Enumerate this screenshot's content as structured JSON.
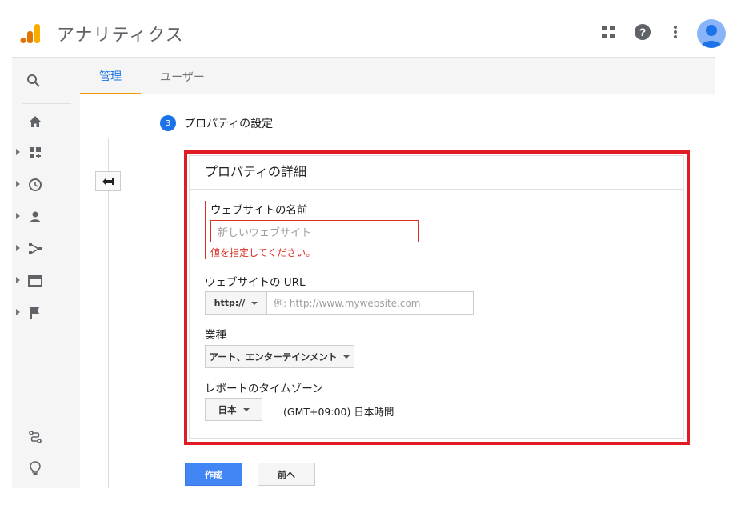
{
  "app": {
    "title": "アナリティクス"
  },
  "header": {
    "icons": [
      "apps-icon",
      "help-icon",
      "more-vert-icon",
      "avatar"
    ]
  },
  "tabs": [
    {
      "label": "管理",
      "active": true
    },
    {
      "label": "ユーザー",
      "active": false
    }
  ],
  "rail": {
    "items": [
      "search-icon",
      "home-icon",
      "dashboard-icon",
      "clock-icon",
      "person-icon",
      "acquisition-icon",
      "behavior-icon",
      "flag-icon",
      "route-icon",
      "lightbulb-icon"
    ]
  },
  "step": {
    "number": "3",
    "title": "プロパティの設定"
  },
  "form": {
    "section_title": "プロパティの詳細",
    "website_name": {
      "label": "ウェブサイトの名前",
      "placeholder": "新しいウェブサイト",
      "error": "値を指定してください。"
    },
    "website_url": {
      "label": "ウェブサイトの URL",
      "protocol": "http://",
      "placeholder": "例: http://www.mywebsite.com"
    },
    "industry": {
      "label": "業種",
      "value": "アート、エンターテインメント"
    },
    "timezone": {
      "label": "レポートのタイムゾーン",
      "country": "日本",
      "zone": "(GMT+09:00) 日本時間"
    }
  },
  "actions": {
    "create": "作成",
    "back": "前へ"
  },
  "colors": {
    "accent": "#1a73e8",
    "highlight": "#e01b22",
    "error": "#d93025",
    "tab_indicator": "#f29900"
  }
}
